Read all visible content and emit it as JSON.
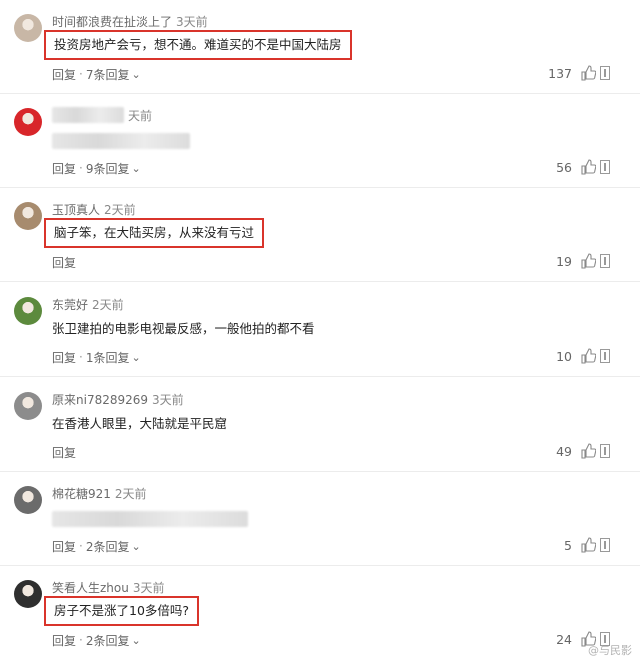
{
  "comments": [
    {
      "user": "时间都浪费在扯淡上了",
      "time": "3天前",
      "text": "投资房地产会亏，想不通。难道买的不是中国大陆房",
      "reply_label": "回复",
      "reply_count": "7条回复",
      "likes": "137",
      "highlighted": true,
      "avatar_color": "#c8b7a6"
    },
    {
      "user": "",
      "time": "天前",
      "text": "",
      "reply_label": "回复",
      "reply_count": "9条回复",
      "likes": "56",
      "highlighted": false,
      "avatar_color": "#d8262a"
    },
    {
      "user": "玉顶真人",
      "time": "2天前",
      "text": "脑子笨，在大陆买房，从来没有亏过",
      "reply_label": "回复",
      "reply_count": "",
      "likes": "19",
      "highlighted": true,
      "avatar_color": "#a78b6e"
    },
    {
      "user": "东莞好",
      "time": "2天前",
      "text": "张卫建拍的电影电视最反感，一般他拍的都不看",
      "reply_label": "回复",
      "reply_count": "1条回复",
      "likes": "10",
      "highlighted": false,
      "avatar_color": "#5c8a3d"
    },
    {
      "user": "原来ni78289269",
      "time": "3天前",
      "text": "在香港人眼里，大陆就是平民窟",
      "reply_label": "回复",
      "reply_count": "",
      "likes": "49",
      "highlighted": false,
      "avatar_color": "#8c8c8c"
    },
    {
      "user": "棉花糖921",
      "time": "2天前",
      "text": "",
      "reply_label": "回复",
      "reply_count": "2条回复",
      "likes": "5",
      "highlighted": false,
      "avatar_color": "#6b6b6b"
    },
    {
      "user": "笑看人生zhou",
      "time": "3天前",
      "text": "房子不是涨了10多倍吗?",
      "reply_label": "回复",
      "reply_count": "2条回复",
      "likes": "24",
      "highlighted": true,
      "avatar_color": "#2f2f2f"
    }
  ],
  "icons": {
    "like": "thumbs-up-icon",
    "report": "report-icon",
    "expand": "chevron-down-icon"
  },
  "watermark": "@与民影"
}
